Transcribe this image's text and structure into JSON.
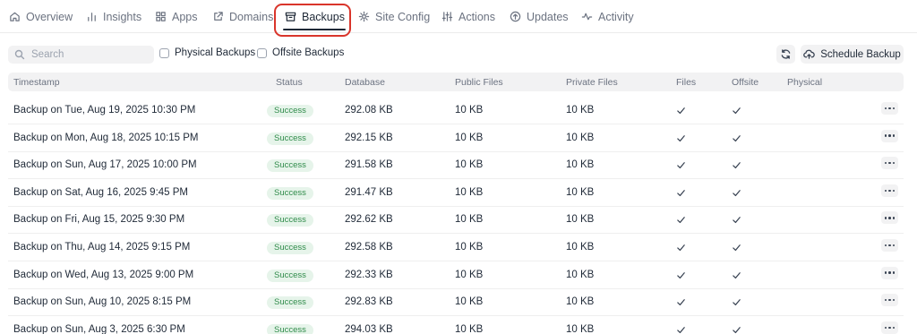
{
  "tabs": [
    {
      "label": "Overview",
      "icon": "home-icon"
    },
    {
      "label": "Insights",
      "icon": "bar-chart-icon"
    },
    {
      "label": "Apps",
      "icon": "grid-icon"
    },
    {
      "label": "Domains",
      "icon": "external-link-icon"
    },
    {
      "label": "Backups",
      "icon": "archive-icon",
      "active": true
    },
    {
      "label": "Site Config",
      "icon": "gear-icon"
    },
    {
      "label": "Actions",
      "icon": "sliders-icon"
    },
    {
      "label": "Updates",
      "icon": "arrow-up-circle-icon"
    },
    {
      "label": "Activity",
      "icon": "activity-icon"
    }
  ],
  "toolbar": {
    "search_placeholder": "Search",
    "physical_label": "Physical Backups",
    "offsite_label": "Offsite Backups",
    "refresh_icon": "refresh-icon",
    "schedule_label": "Schedule Backup",
    "schedule_icon": "cloud-upload-icon"
  },
  "table": {
    "columns": [
      "Timestamp",
      "Status",
      "Database",
      "Public Files",
      "Private Files",
      "Files",
      "Offsite",
      "Physical"
    ],
    "rows": [
      {
        "timestamp": "Backup on Tue, Aug 19, 2025 10:30 PM",
        "status": "Success",
        "database": "292.08 KB",
        "public": "10 KB",
        "private": "10 KB",
        "files": true,
        "offsite": true
      },
      {
        "timestamp": "Backup on Mon, Aug 18, 2025 10:15 PM",
        "status": "Success",
        "database": "292.15 KB",
        "public": "10 KB",
        "private": "10 KB",
        "files": true,
        "offsite": true
      },
      {
        "timestamp": "Backup on Sun, Aug 17, 2025 10:00 PM",
        "status": "Success",
        "database": "291.58 KB",
        "public": "10 KB",
        "private": "10 KB",
        "files": true,
        "offsite": true
      },
      {
        "timestamp": "Backup on Sat, Aug 16, 2025 9:45 PM",
        "status": "Success",
        "database": "291.47 KB",
        "public": "10 KB",
        "private": "10 KB",
        "files": true,
        "offsite": true
      },
      {
        "timestamp": "Backup on Fri, Aug 15, 2025 9:30 PM",
        "status": "Success",
        "database": "292.62 KB",
        "public": "10 KB",
        "private": "10 KB",
        "files": true,
        "offsite": true
      },
      {
        "timestamp": "Backup on Thu, Aug 14, 2025 9:15 PM",
        "status": "Success",
        "database": "292.58 KB",
        "public": "10 KB",
        "private": "10 KB",
        "files": true,
        "offsite": true
      },
      {
        "timestamp": "Backup on Wed, Aug 13, 2025 9:00 PM",
        "status": "Success",
        "database": "292.33 KB",
        "public": "10 KB",
        "private": "10 KB",
        "files": true,
        "offsite": true
      },
      {
        "timestamp": "Backup on Sun, Aug 10, 2025 8:15 PM",
        "status": "Success",
        "database": "292.83 KB",
        "public": "10 KB",
        "private": "10 KB",
        "files": true,
        "offsite": true
      },
      {
        "timestamp": "Backup on Sun, Aug 3, 2025 6:30 PM",
        "status": "Success",
        "database": "294.03 KB",
        "public": "10 KB",
        "private": "10 KB",
        "files": true,
        "offsite": true
      }
    ]
  },
  "colors": {
    "highlight": "#d9352b",
    "success_bg": "#e6f4ea",
    "success_text": "#2f8b4a"
  }
}
